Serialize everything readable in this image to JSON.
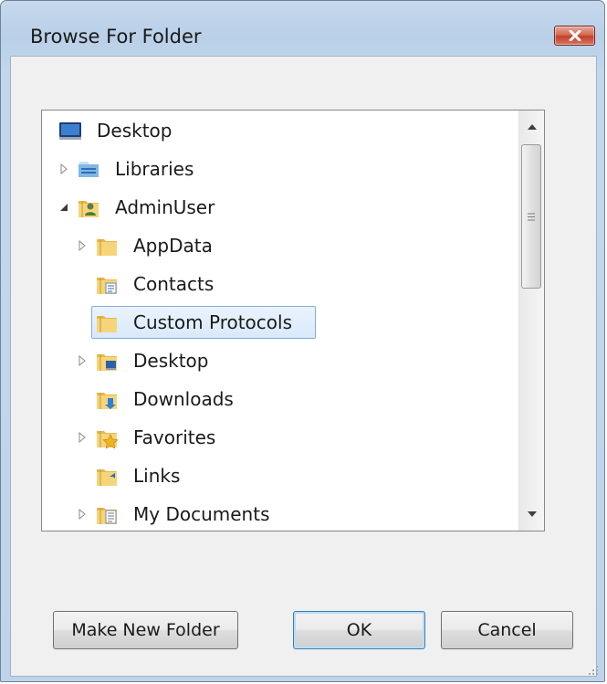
{
  "window": {
    "title": "Browse For Folder",
    "close_label": "Close"
  },
  "tree": {
    "items": [
      {
        "label": "Desktop",
        "icon": "desktop-icon",
        "expander": "none",
        "level": 0
      },
      {
        "label": "Libraries",
        "icon": "libraries-icon",
        "expander": "collapsed",
        "level": 0
      },
      {
        "label": "AdminUser",
        "icon": "user-folder-icon",
        "expander": "expanded",
        "level": 0
      },
      {
        "label": "AppData",
        "icon": "folder-icon",
        "expander": "collapsed",
        "level": 1
      },
      {
        "label": "Contacts",
        "icon": "contacts-folder-icon",
        "expander": "none",
        "level": 1
      },
      {
        "label": "Custom Protocols",
        "icon": "folder-icon",
        "expander": "none",
        "level": 1,
        "selected": true
      },
      {
        "label": "Desktop",
        "icon": "desktop-folder-icon",
        "expander": "collapsed",
        "level": 1
      },
      {
        "label": "Downloads",
        "icon": "downloads-folder-icon",
        "expander": "none",
        "level": 1
      },
      {
        "label": "Favorites",
        "icon": "favorites-folder-icon",
        "expander": "collapsed",
        "level": 1
      },
      {
        "label": "Links",
        "icon": "links-folder-icon",
        "expander": "none",
        "level": 1
      },
      {
        "label": "My Documents",
        "icon": "documents-folder-icon",
        "expander": "collapsed",
        "level": 1
      }
    ]
  },
  "buttons": {
    "make_new_folder": "Make New Folder",
    "ok": "OK",
    "cancel": "Cancel"
  },
  "colors": {
    "selection_border": "#84acdd",
    "close_button": "#c2412a"
  }
}
